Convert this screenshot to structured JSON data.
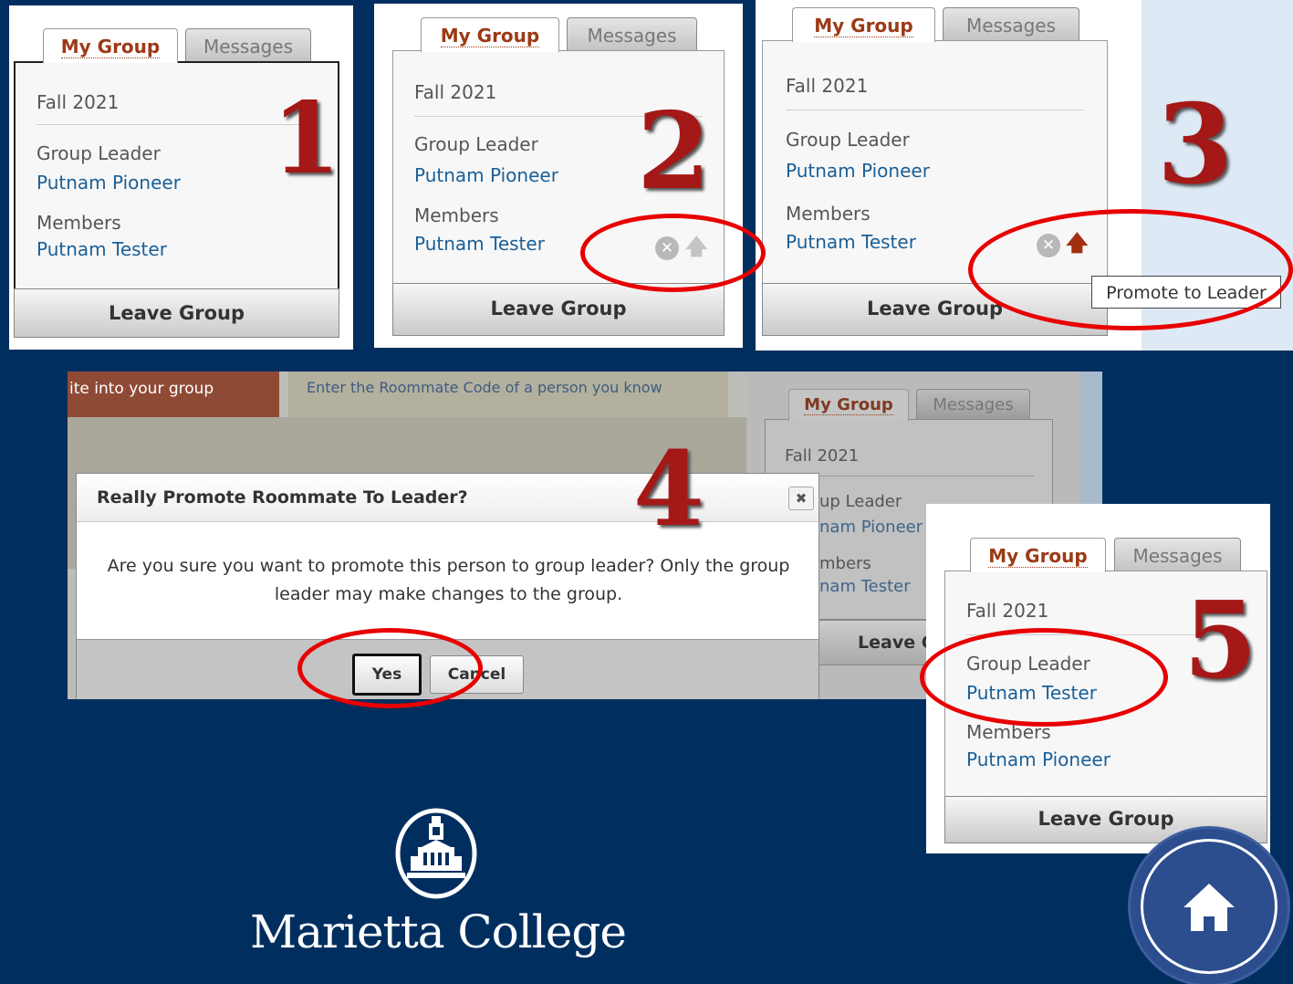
{
  "tabs": {
    "my_group": "My Group",
    "messages": "Messages"
  },
  "group": {
    "term": "Fall 2021",
    "leader_label": "Group Leader",
    "members_label": "Members",
    "leave_button": "Leave Group",
    "before": {
      "leader": "Putnam Pioneer",
      "member": "Putnam Tester"
    },
    "after": {
      "leader": "Putnam Tester",
      "member": "Putnam Pioneer"
    }
  },
  "steps": [
    "1",
    "2",
    "3",
    "4",
    "5"
  ],
  "icons": {
    "remove": "remove-circle-icon",
    "promote": "promote-arrow-icon",
    "close": "close-icon",
    "home": "home-icon"
  },
  "tooltip": {
    "promote": "Promote to Leader"
  },
  "step4": {
    "banner_left": "ite into your group",
    "banner_right": "Enter the Roommate Code of a person you know",
    "bg_leader_label": "up Leader",
    "bg_leader": "nam Pioneer",
    "bg_members_label": "mbers",
    "bg_member": "nam Tester",
    "bg_leave": "Leave G"
  },
  "dialog": {
    "title": "Really Promote Roommate To Leader?",
    "message": "Are you sure you want to promote this person to group leader? Only the group leader may make changes to the group.",
    "yes": "Yes",
    "cancel": "Cancel"
  },
  "logo": {
    "name": "Marietta College"
  },
  "colors": {
    "background": "#002f5f",
    "accent": "#9c3a16",
    "link": "#1a5f97",
    "highlight_ring": "#e80000",
    "step_number": "#a51818"
  }
}
